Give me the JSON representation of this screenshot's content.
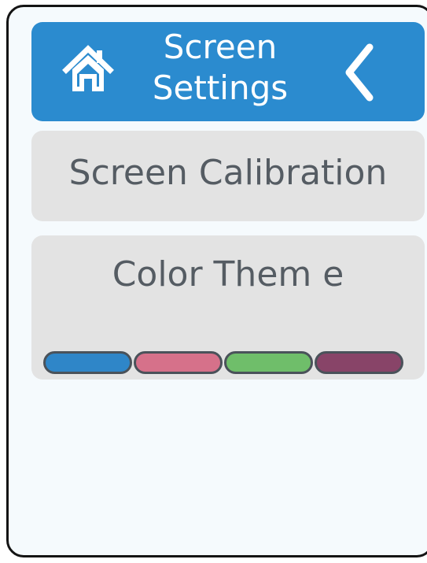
{
  "header": {
    "title_line1": "Screen",
    "title_line2": "Settings",
    "home_icon": "home-icon",
    "back_icon": "chevron-left-icon",
    "color": "#2b8bcf"
  },
  "menu": {
    "calibration_label": "Screen Calibration",
    "color_theme_label": "Color Them e"
  },
  "themes": [
    {
      "name": "blue",
      "color": "#2f86c8"
    },
    {
      "name": "pink",
      "color": "#d6718a"
    },
    {
      "name": "green",
      "color": "#6fbe6a"
    },
    {
      "name": "plum",
      "color": "#884468"
    }
  ]
}
